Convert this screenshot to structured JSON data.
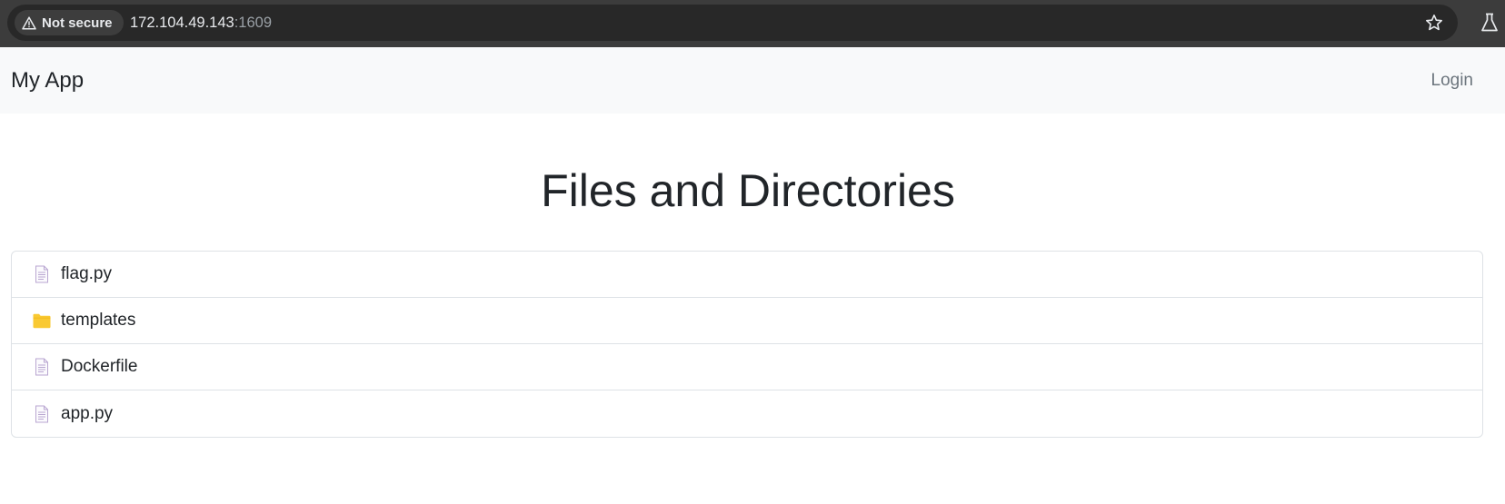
{
  "browser": {
    "security_label": "Not secure",
    "url_host": "172.104.49.143",
    "url_port": ":1609"
  },
  "navbar": {
    "brand": "My App",
    "login_label": "Login"
  },
  "main": {
    "title": "Files and Directories",
    "items": [
      {
        "name": "flag.py",
        "type": "file",
        "icon": "file-icon"
      },
      {
        "name": "templates",
        "type": "directory",
        "icon": "folder-icon"
      },
      {
        "name": "Dockerfile",
        "type": "file",
        "icon": "file-icon"
      },
      {
        "name": "app.py",
        "type": "file",
        "icon": "file-icon"
      }
    ]
  },
  "colors": {
    "chrome_bg": "#3c3c3c",
    "navbar_bg": "#f8f9fa",
    "folder": "#f9c932",
    "file_icon": "#b9a6d1"
  }
}
